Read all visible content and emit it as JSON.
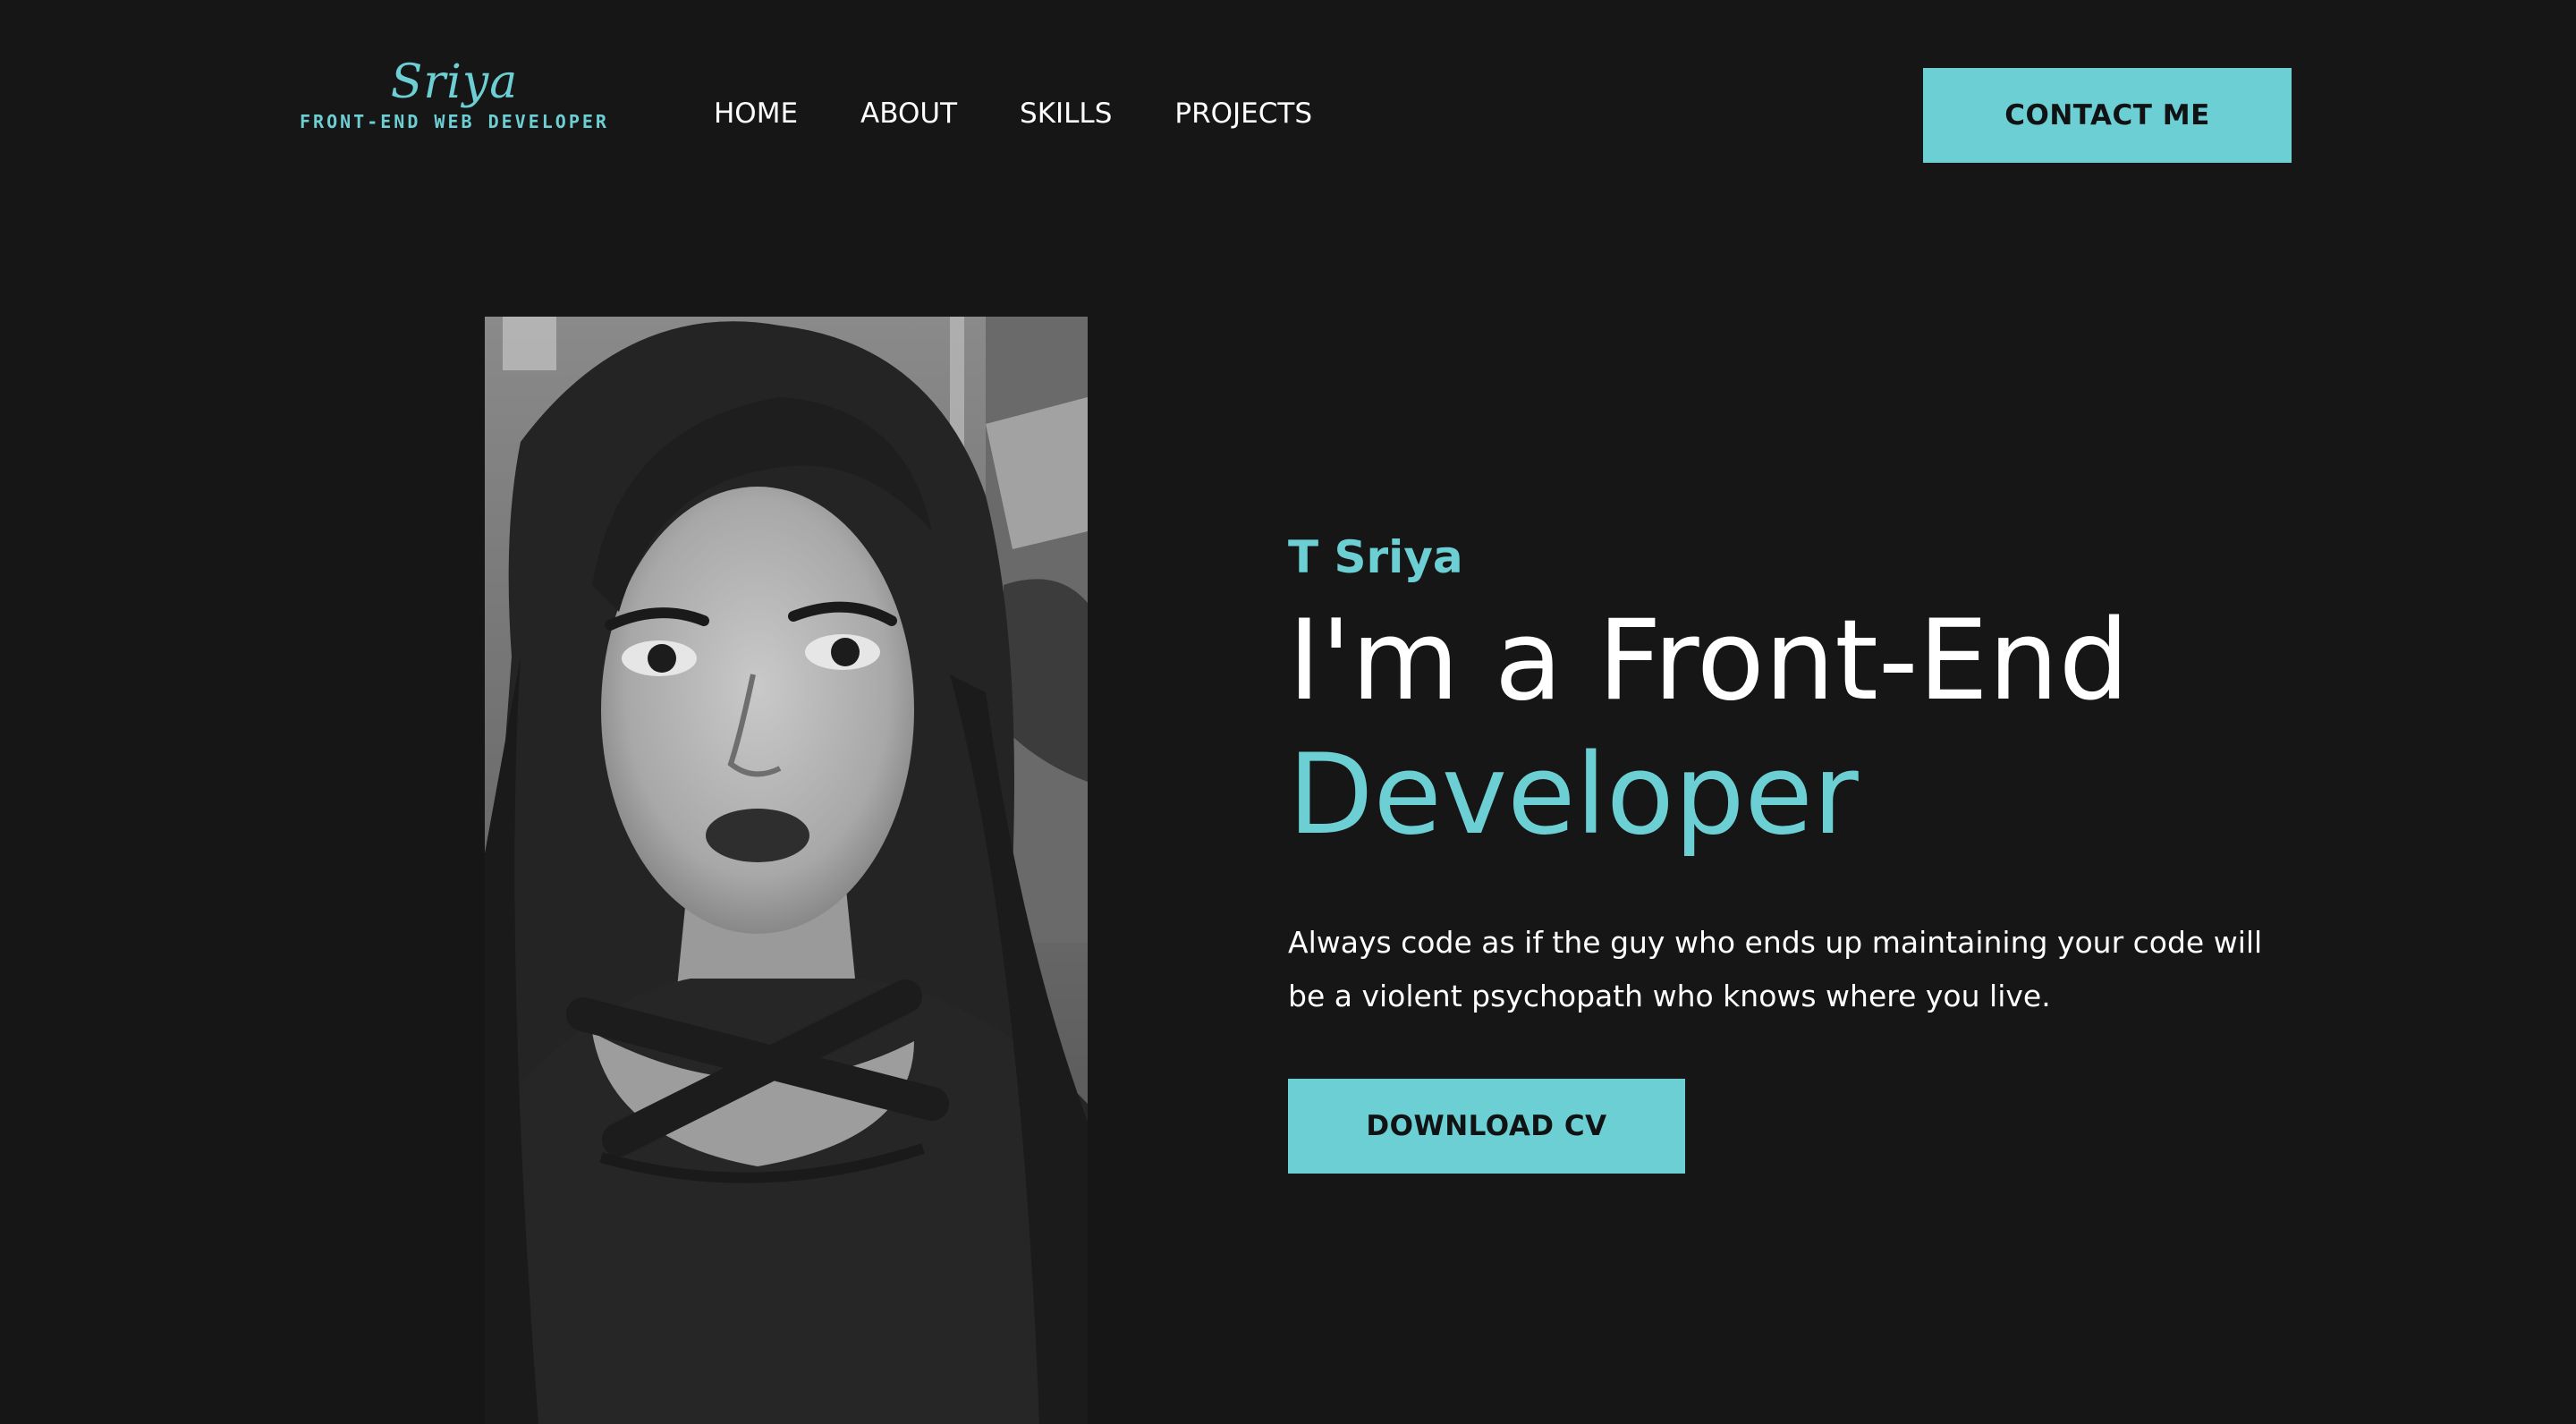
{
  "header": {
    "logo": {
      "name": "Sriya",
      "tagline": "FRONT-END WEB DEVELOPER"
    },
    "nav": [
      {
        "label": "HOME"
      },
      {
        "label": "ABOUT"
      },
      {
        "label": "SKILLS"
      },
      {
        "label": "PROJECTS"
      }
    ],
    "contact_label": "CONTACT ME"
  },
  "hero": {
    "name": "T Sriya",
    "title_line1": "I'm a Front-End",
    "title_line2": "Developer",
    "quote": "Always code as if the guy who ends up maintaining your code will be a violent psychopath who knows where you live.",
    "download_label": "DOWNLOAD CV"
  },
  "colors": {
    "background": "#161617",
    "accent": "#6ccfd3",
    "text": "#ffffff",
    "button_text": "#111213"
  },
  "icons": {
    "portrait": "profile-photo"
  }
}
